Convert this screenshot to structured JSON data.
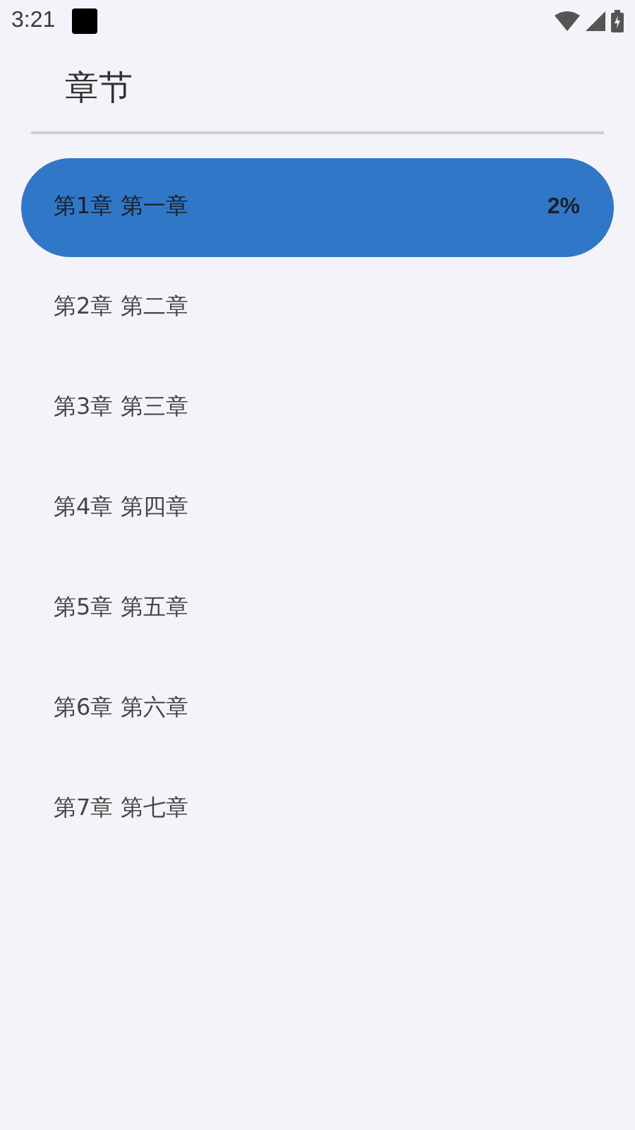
{
  "status_bar": {
    "time": "3:21"
  },
  "title": "章节",
  "chapters": [
    {
      "label": "第1章 第一章",
      "progress": "2%",
      "selected": true
    },
    {
      "label": "第2章 第二章",
      "selected": false
    },
    {
      "label": "第3章 第三章",
      "selected": false
    },
    {
      "label": "第4章 第四章",
      "selected": false
    },
    {
      "label": "第5章 第五章",
      "selected": false
    },
    {
      "label": "第6章 第六章",
      "selected": false
    },
    {
      "label": "第7章 第七章",
      "selected": false
    }
  ]
}
